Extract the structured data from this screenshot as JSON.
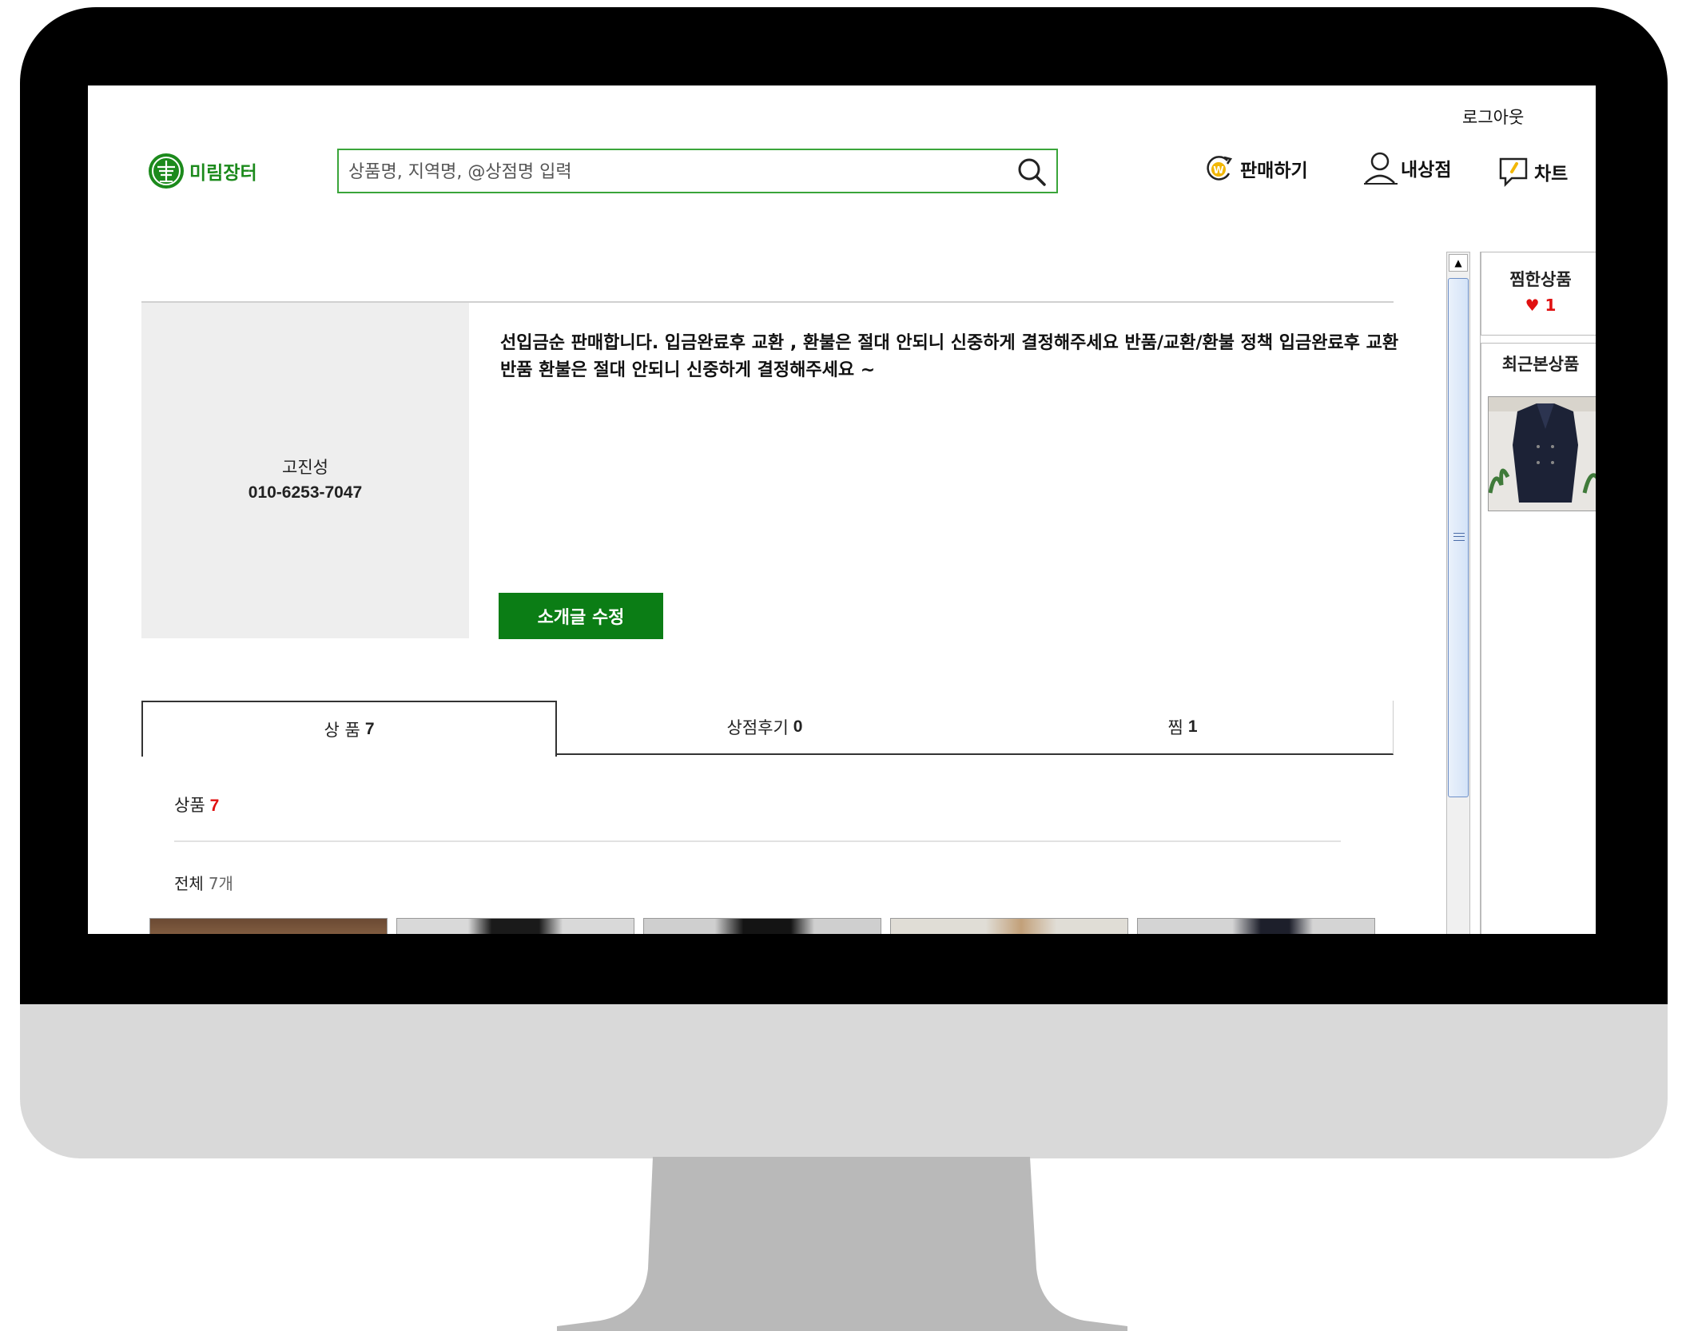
{
  "header": {
    "logout_label": "로그아웃",
    "logo_text": "미림장터",
    "search_placeholder": "상품명, 지역명, @상점명 입력",
    "sell_label": "판매하기",
    "mystore_label": "내상점",
    "chat_label": "차트"
  },
  "sidebar": {
    "wish_title": "찜한상품",
    "wish_count": "♥ 1",
    "recent_title": "최근본상품"
  },
  "profile": {
    "name": "고진성",
    "phone": "010-6253-7047",
    "intro": "선입금순 판매합니다. 입금완료후 교환 , 환불은 절대 안되니 신중하게 결정해주세요 반품/교환/환불 정책 입금완료후 교환 반품 환불은 절대 안되니 신중하게 결정해주세요 ~",
    "edit_button": "소개글 수정"
  },
  "tabs": [
    {
      "label": "상 품",
      "count": "7"
    },
    {
      "label": "상점후기",
      "count": "0"
    },
    {
      "label": "찜",
      "count": "1"
    }
  ],
  "products": {
    "heading": "상품",
    "heading_count": "7",
    "total_label": "전체",
    "total_count": "7개"
  },
  "colors": {
    "brand_green": "#0b7d15",
    "search_border": "#3aa53a",
    "accent_red": "#e01010"
  }
}
